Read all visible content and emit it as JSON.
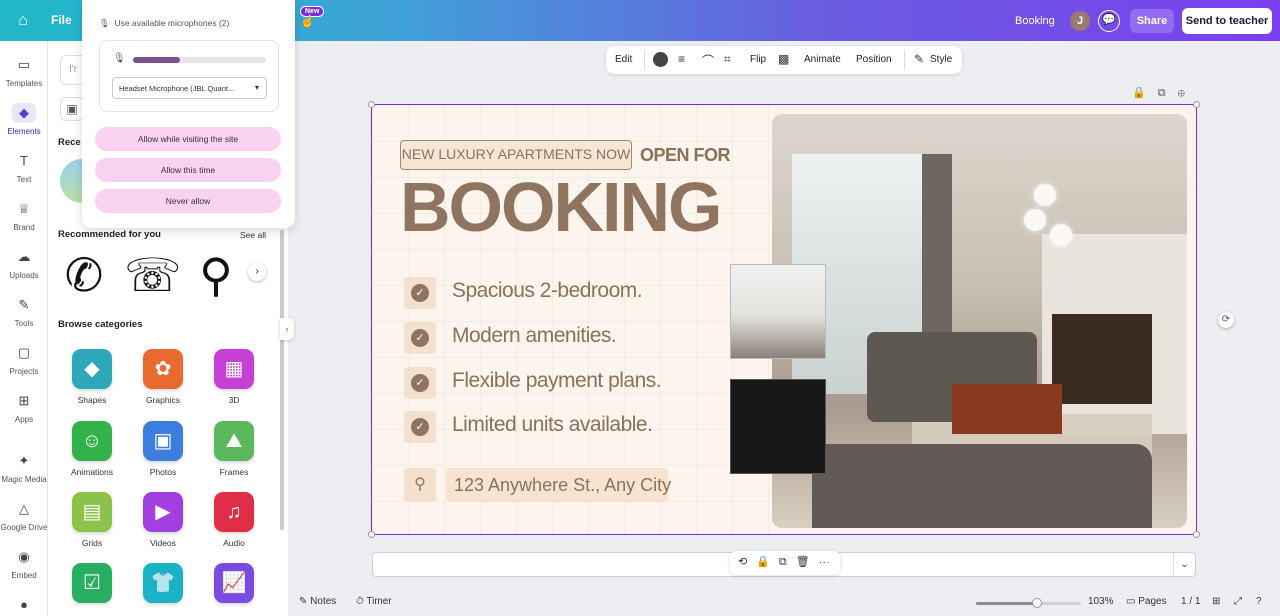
{
  "topbar": {
    "file_label": "File",
    "new_badge": "New",
    "design_title": "Booking",
    "avatar_initial": "J",
    "share_label": "Share",
    "send_label": "Send to teacher"
  },
  "rail": [
    {
      "label": "Templates",
      "icon": "templates-icon"
    },
    {
      "label": "Elements",
      "icon": "elements-icon"
    },
    {
      "label": "Text",
      "icon": "text-icon"
    },
    {
      "label": "Brand",
      "icon": "brand-icon"
    },
    {
      "label": "Uploads",
      "icon": "uploads-icon"
    },
    {
      "label": "Tools",
      "icon": "tools-icon"
    },
    {
      "label": "Projects",
      "icon": "projects-icon"
    },
    {
      "label": "Apps",
      "icon": "apps-icon"
    },
    {
      "label": "Magic Media",
      "icon": "magic-media-icon"
    },
    {
      "label": "Google Drive",
      "icon": "google-drive-icon"
    },
    {
      "label": "Embed",
      "icon": "embed-icon"
    }
  ],
  "panel": {
    "search_stub": "I'r",
    "recent_heading": "Rece",
    "recommended_heading": "Recommended for you",
    "see_all": "See all",
    "browse_heading": "Browse categories",
    "categories": [
      {
        "label": "Shapes",
        "color": "#2ea7b8"
      },
      {
        "label": "Graphics",
        "color": "#e86a2e"
      },
      {
        "label": "3D",
        "color": "#c63fd6"
      },
      {
        "label": "Animations",
        "color": "#34b24a"
      },
      {
        "label": "Photos",
        "color": "#3d7de0"
      },
      {
        "label": "Frames",
        "color": "#5cb85c"
      },
      {
        "label": "Grids",
        "color": "#8bc34a"
      },
      {
        "label": "Videos",
        "color": "#a13fe0"
      },
      {
        "label": "Audio",
        "color": "#e02e48"
      },
      {
        "label": "",
        "color": "#27ae60"
      },
      {
        "label": "",
        "color": "#1ab3c6"
      },
      {
        "label": "",
        "color": "#7a4be0"
      }
    ]
  },
  "mic_popup": {
    "use_available": "Use available microphones (2)",
    "mic_level": 0.35,
    "device": "Headset Microphone (JBL Quant...",
    "allow_visiting": "Allow while visiting the site",
    "allow_once": "Allow this time",
    "never_allow": "Never allow"
  },
  "toolbar": {
    "edit": "Edit",
    "flip": "Flip",
    "animate": "Animate",
    "position": "Position",
    "style": "Style"
  },
  "design": {
    "tag": "NEW LUXURY APARTMENTS NOW",
    "open_for": "OPEN FOR",
    "headline": "BOOKING",
    "features": [
      "Spacious 2-bedroom.",
      "Modern amenities.",
      "Flexible payment plans.",
      "Limited units available."
    ],
    "address": "123 Anywhere St., Any City"
  },
  "footer": {
    "notes": "Notes",
    "timer": "Timer",
    "zoom": "103%",
    "zoom_level": 0.58,
    "pages_label": "Pages",
    "page_count": "1 / 1"
  },
  "colors": {
    "accent": "#7d2ae8",
    "brand_brown": "#8f7560",
    "popup_button": "#f9d2f1"
  }
}
